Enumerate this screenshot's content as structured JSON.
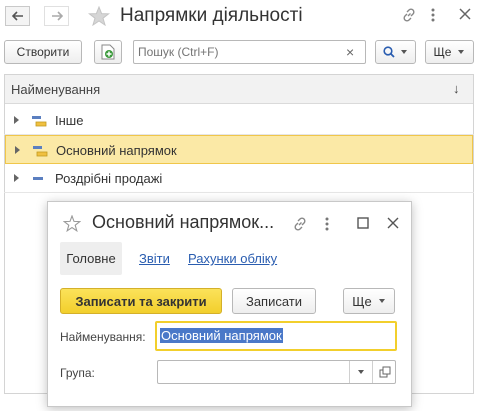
{
  "window": {
    "title": "Напрямки діяльності"
  },
  "toolbar": {
    "create_label": "Створити",
    "search_placeholder": "Пошук (Ctrl+F)",
    "search_clear": "×",
    "more_label": "Ще"
  },
  "list": {
    "column_header": "Найменування",
    "sort_indicator": "↓",
    "rows": [
      {
        "label": "Інше",
        "selected": false
      },
      {
        "label": "Основний напрямок",
        "selected": true
      },
      {
        "label": "Роздрібні продажі",
        "selected": false
      }
    ]
  },
  "dialog": {
    "title": "Основний напрямок...",
    "tabs": [
      {
        "label": "Головне",
        "active": true
      },
      {
        "label": "Звіти",
        "active": false
      },
      {
        "label": "Рахунки обліку",
        "active": false
      }
    ],
    "save_close_label": "Записати та закрити",
    "save_label": "Записати",
    "more_label": "Ще",
    "name_label": "Найменування:",
    "name_value": "Основний напрямок",
    "group_label": "Група:",
    "group_value": ""
  },
  "colors": {
    "accent_yellow": "#f5d142",
    "selected_row": "#fbe9a6",
    "link_blue": "#2a5db0",
    "green_icon": "#3c9a3c"
  }
}
